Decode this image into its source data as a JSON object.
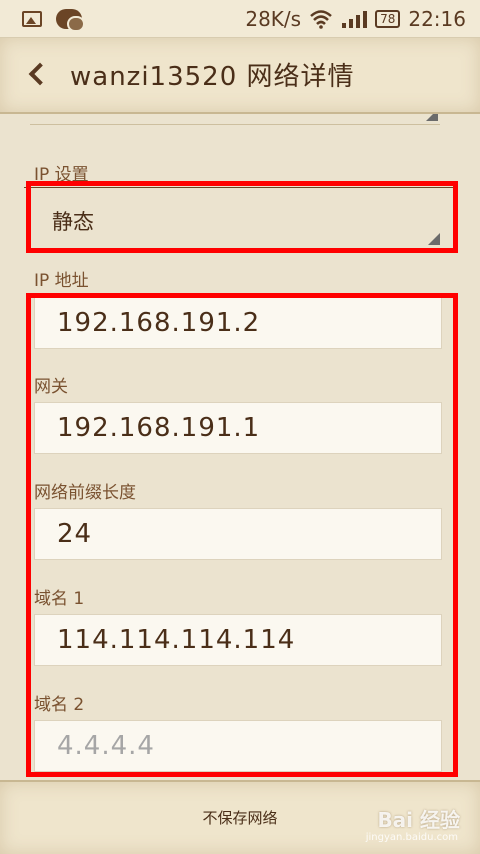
{
  "status_bar": {
    "speed": "28K/s",
    "battery": "78",
    "time": "22:16"
  },
  "header": {
    "title": "wanzi13520 网络详情"
  },
  "form": {
    "ip_settings_label": "IP 设置",
    "ip_settings_value": "静态",
    "ip_address_label": "IP 地址",
    "ip_address_value": "192.168.191.2",
    "gateway_label": "网关",
    "gateway_value": "192.168.191.1",
    "prefix_label": "网络前缀长度",
    "prefix_value": "24",
    "dns1_label": "域名 1",
    "dns1_value": "114.114.114.114",
    "dns2_label": "域名 2",
    "dns2_placeholder": "4.4.4.4"
  },
  "footer": {
    "forget_label": "不保存网络",
    "watermark": "Bai 经验",
    "watermark_sub": "jingyan.baidu.com"
  },
  "colors": {
    "highlight": "#ff0000",
    "background": "#ebe3cf",
    "text": "#4a2e18"
  }
}
